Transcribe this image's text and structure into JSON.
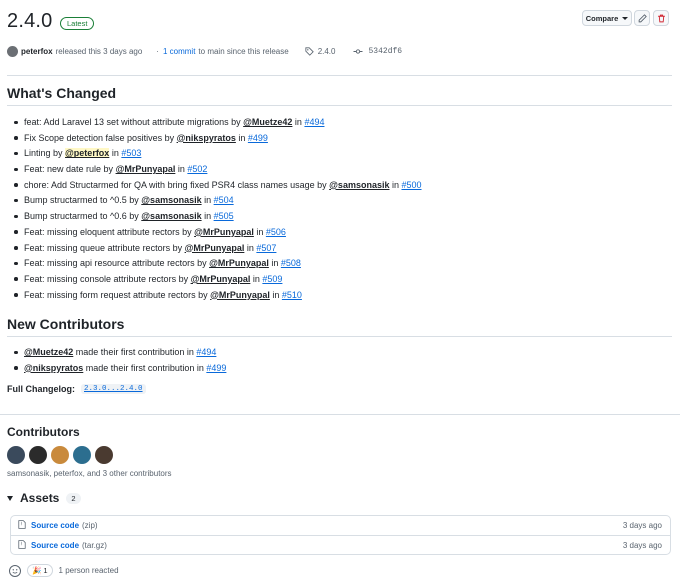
{
  "release": {
    "version": "2.4.0",
    "latest_badge": "Latest",
    "compare_label": "Compare",
    "author": "peterfox",
    "released_text": "released this 3 days ago",
    "commits_link": "1 commit",
    "commits_suffix": "to main since this release",
    "tag": "2.4.0",
    "commit_sha": "5342df6"
  },
  "whats_changed": {
    "title": "What's Changed",
    "items": [
      {
        "text": "feat: Add Laravel 13 set without attribute migrations by ",
        "user": "@Muetze42",
        "mid": " in ",
        "pr": "#494"
      },
      {
        "text": "Fix Scope detection false positives by ",
        "user": "@nikspyratos",
        "mid": " in ",
        "pr": "#499"
      },
      {
        "text": "Linting by ",
        "user": "@peterfox",
        "mid": " in ",
        "pr": "#503"
      },
      {
        "text": "Feat: new date rule by ",
        "user": "@MrPunyapal",
        "mid": " in ",
        "pr": "#502"
      },
      {
        "text": "chore: Add Structarmed for QA with bring fixed PSR4 class names usage by ",
        "user": "@samsonasik",
        "mid": " in ",
        "pr": "#500"
      },
      {
        "text": "Bump structarmed to ^0.5 by ",
        "user": "@samsonasik",
        "mid": " in ",
        "pr": "#504"
      },
      {
        "text": "Bump structarmed to ^0.6 by ",
        "user": "@samsonasik",
        "mid": " in ",
        "pr": "#505"
      },
      {
        "text": "Feat: missing eloquent attribute rectors by ",
        "user": "@MrPunyapal",
        "mid": " in ",
        "pr": "#506"
      },
      {
        "text": "Feat: missing queue attribute rectors by ",
        "user": "@MrPunyapal",
        "mid": " in ",
        "pr": "#507"
      },
      {
        "text": "Feat: missing api resource attribute rectors by ",
        "user": "@MrPunyapal",
        "mid": " in ",
        "pr": "#508"
      },
      {
        "text": "Feat: missing console attribute rectors by ",
        "user": "@MrPunyapal",
        "mid": " in ",
        "pr": "#509"
      },
      {
        "text": "Feat: missing form request attribute rectors by ",
        "user": "@MrPunyapal",
        "mid": " in ",
        "pr": "#510"
      }
    ]
  },
  "new_contributors": {
    "title": "New Contributors",
    "items": [
      {
        "user": "@Muetze42",
        "text": " made their first contribution in ",
        "pr": "#494"
      },
      {
        "user": "@nikspyratos",
        "text": " made their first contribution in ",
        "pr": "#499"
      }
    ]
  },
  "full_changelog": {
    "label": "Full Changelog:",
    "range": "2.3.0...2.4.0"
  },
  "contributors": {
    "title": "Contributors",
    "summary": "samsonasik, peterfox, and 3 other contributors",
    "avatar_colors": [
      "#3a4a5c",
      "#2b2b2b",
      "#c98a3c",
      "#2c6e8f",
      "#4a3a30"
    ]
  },
  "assets": {
    "title": "Assets",
    "count": "2",
    "items": [
      {
        "name": "Source code",
        "ext": "(zip)",
        "date": "3 days ago"
      },
      {
        "name": "Source code",
        "ext": "(tar.gz)",
        "date": "3 days ago"
      }
    ]
  },
  "reactions": {
    "emoji": "🎉",
    "count": "1",
    "summary": "1 person reacted"
  },
  "icons": {
    "edit": "pencil-icon",
    "delete": "trash-icon",
    "tag": "tag-icon",
    "commit": "git-commit-icon",
    "file": "file-zip-icon",
    "smile": "smiley-icon"
  },
  "colors": {
    "link": "#0969da",
    "latest": "#1a7f37",
    "danger": "#cf222e"
  }
}
